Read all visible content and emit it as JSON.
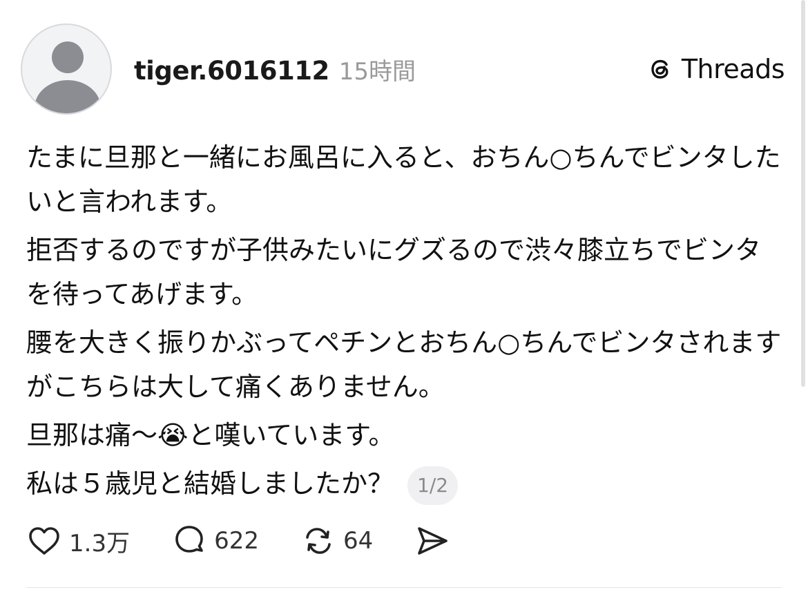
{
  "post": {
    "username": "tiger.6016112",
    "timestamp": "15時間",
    "brand": "Threads",
    "paragraphs": [
      "たまに旦那と一緒にお風呂に入ると、おちん○ちんでビンタしたいと言われます。",
      "拒否するのですが子供みたいにグズるので渋々膝立ちでビンタを待ってあげます。",
      "腰を大きく振りかぶってペチンとおちん○ちんでビンタされますがこちらは大して痛くありません。"
    ],
    "emoji_line": {
      "before": "旦那は痛〜",
      "emoji": "😭",
      "after": "と嘆いています。"
    },
    "last_line": "私は５歳児と結婚しましたか？",
    "page_indicator": "1/2"
  },
  "actions": {
    "likes": "1.3万",
    "replies": "622",
    "reposts": "64"
  },
  "icons": {
    "avatar": "default-avatar-icon",
    "brand": "threads-logo-icon",
    "like": "heart-icon",
    "reply": "speech-bubble-icon",
    "repost": "repost-arrows-icon",
    "share": "send-icon"
  },
  "colors": {
    "text": "#111111",
    "muted": "#9a9a9a",
    "avatar_fill": "#8b8d93",
    "pill_bg": "#f0f0f2"
  }
}
